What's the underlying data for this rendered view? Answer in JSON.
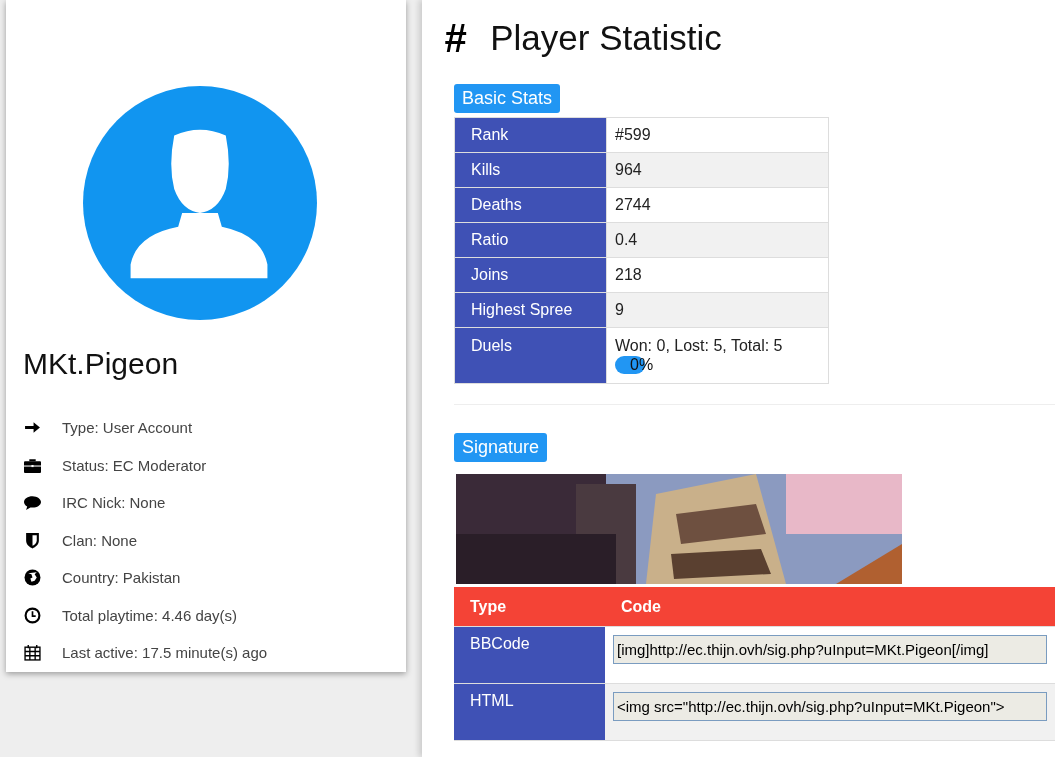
{
  "profile": {
    "name": "MKt.Pigeon",
    "details": [
      {
        "text": "Type: User Account"
      },
      {
        "text": "Status: EC Moderator"
      },
      {
        "text": "IRC Nick: None"
      },
      {
        "text": "Clan: None"
      },
      {
        "text": "Country: Pakistan"
      },
      {
        "text": "Total playtime: 4.46 day(s)"
      },
      {
        "text": "Last active: 17.5 minute(s) ago"
      }
    ]
  },
  "heading": {
    "icon": "#",
    "title": "Player Statistic"
  },
  "basic_stats": {
    "title": "Basic Stats",
    "rows": [
      {
        "label": "Rank",
        "value": "#599"
      },
      {
        "label": "Kills",
        "value": "964"
      },
      {
        "label": "Deaths",
        "value": "2744"
      },
      {
        "label": "Ratio",
        "value": "0.4"
      },
      {
        "label": "Joins",
        "value": "218"
      },
      {
        "label": "Highest Spree",
        "value": "9"
      },
      {
        "label": "Duels",
        "value": "Won: 0, Lost: 5, Total: 5",
        "progress": {
          "level": 0,
          "reading": "0%"
        }
      }
    ]
  },
  "signature": {
    "title": "Signature",
    "columns": [
      "Type",
      "Code"
    ],
    "rows": [
      {
        "type": "BBCode",
        "code": "[img]http://ec.thijn.ovh/sig.php?uInput=MKt.Pigeon[/img]"
      },
      {
        "type": "HTML",
        "code": "<img src=\"http://ec.thijn.ovh/sig.php?uInput=MKt.Pigeon\">"
      }
    ]
  }
}
